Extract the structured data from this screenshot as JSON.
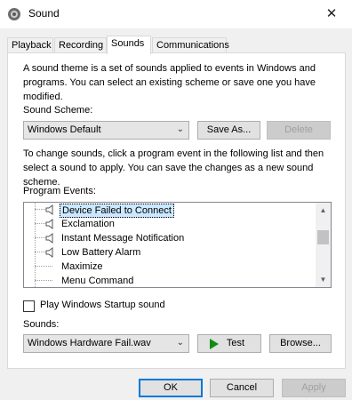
{
  "window": {
    "title": "Sound",
    "close_glyph": "✕"
  },
  "tabs": [
    {
      "label": "Playback"
    },
    {
      "label": "Recording"
    },
    {
      "label": "Sounds",
      "active": true
    },
    {
      "label": "Communications"
    }
  ],
  "intro_text": "A sound theme is a set of sounds applied to events in Windows and programs.  You can select an existing scheme or save one you have modified.",
  "scheme": {
    "label": "Sound Scheme:",
    "value": "Windows Default",
    "save_as_label": "Save As...",
    "delete_label": "Delete"
  },
  "instructions_text": "To change sounds, click a program event in the following list and then select a sound to apply.  You can save the changes as a new sound scheme.",
  "events": {
    "label": "Program Events:",
    "items": [
      {
        "label": "Device Failed to Connect",
        "has_sound": true,
        "selected": true
      },
      {
        "label": "Exclamation",
        "has_sound": true
      },
      {
        "label": "Instant Message Notification",
        "has_sound": true
      },
      {
        "label": "Low Battery Alarm",
        "has_sound": true
      },
      {
        "label": "Maximize",
        "has_sound": false
      },
      {
        "label": "Menu Command",
        "has_sound": false
      }
    ]
  },
  "startup": {
    "label": "Play Windows Startup sound",
    "checked": false
  },
  "sounds": {
    "label": "Sounds:",
    "value": "Windows Hardware Fail.wav",
    "test_label": "Test",
    "browse_label": "Browse..."
  },
  "footer": {
    "ok_label": "OK",
    "cancel_label": "Cancel",
    "apply_label": "Apply"
  },
  "colors": {
    "accent": "#0078d7",
    "selection": "#cce8ff",
    "play": "#118c11"
  }
}
